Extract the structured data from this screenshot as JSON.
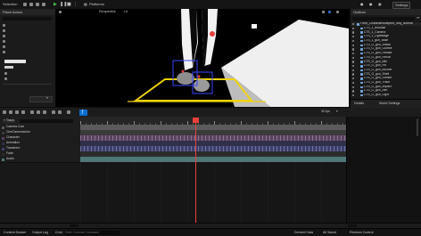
{
  "colors": {
    "accent_blue": "#0a6ed1",
    "play_green": "#46c84b",
    "playhead_red": "#e8413c",
    "floor_yellow": "#f2d40a",
    "gizmo_blue": "#3b47ff"
  },
  "topbar": {
    "mode_label": "Selection",
    "platforms_label": "Platforms",
    "settings_label": "Settings"
  },
  "left_panel": {
    "tab_label": "Place Actors"
  },
  "viewport": {
    "perspective_label": "Perspective",
    "lit_label": "Lit"
  },
  "outliner": {
    "tab_label": "Outliner",
    "root": "Form_CharacterBlueprint_Seq_Normal",
    "children": [
      "C7S_1_boundle",
      "C7S_1_Camera",
      "C7S_1_Lightstage",
      "C7S_1_gun_base",
      "C7S_G_gun_Attack",
      "C7S_G_gun_Gunfire",
      "C7S_G_gun_Reload",
      "C7S_G_gun_Recoil",
      "C7S_G_gun_Idle",
      "C7S_G_gun_Hit",
      "C7S_G_gun_Muzzle",
      "C7S_G_gun_Shell",
      "C7S_G_gun_Smoke",
      "C7S_G_gun_Trace",
      "C7S_G_gun_Impact",
      "C7S_G_gun_Aim",
      "C7S_G_gun_Light"
    ]
  },
  "right_tabs": {
    "details_label": "Details",
    "world_label": "World Settings"
  },
  "sequencer": {
    "add_track_label": "+ Track",
    "fps_label": "30 fps",
    "tracks": [
      {
        "label": "Camera Cuts",
        "color": "#5b5b5b",
        "keyframes": false
      },
      {
        "label": "CineCameraActor",
        "color": "#3a3a3a",
        "keyframes": false
      },
      {
        "label": "Character",
        "color": "#5a4260",
        "keyframes": true
      },
      {
        "label": "Animation",
        "color": "#30304a",
        "keyframes": false
      },
      {
        "label": "Transform",
        "color": "#3c3f70",
        "keyframes": true
      },
      {
        "label": "Fade",
        "color": "#2c2c2c",
        "keyframes": false
      },
      {
        "label": "Audio",
        "color": "#4d7877",
        "keyframes": false
      }
    ]
  },
  "statusbar": {
    "content_drawer_label": "Content Drawer",
    "output_log_label": "Output Log",
    "cmd_label": "Cmd",
    "cmd_placeholder": "Enter Console Command",
    "derived_data_label": "Derived Data",
    "all_saved_label": "All Saved",
    "revision_control_label": "Revision Control"
  }
}
